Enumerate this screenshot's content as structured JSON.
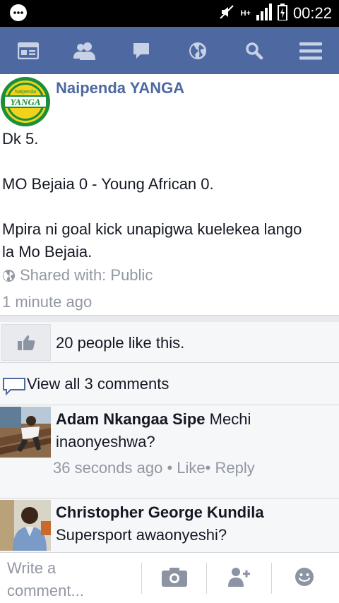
{
  "status_bar": {
    "time": "00:22",
    "network": "H+"
  },
  "nav": {
    "items": [
      "news-feed",
      "friend-requests",
      "messages",
      "notifications",
      "search",
      "more-menu"
    ]
  },
  "post": {
    "page_name": "Naipenda YANGA",
    "avatar_text_top": "Naipenda",
    "avatar_text_main": "YANGA",
    "lines": [
      "Dk 5.",
      "",
      "MO Bejaia 0 - Young African 0.",
      "",
      "Mpira ni goal kick unapigwa kuelekea lango",
      "la Mo Bejaia."
    ],
    "shared_with": "Shared with: Public",
    "timestamp": "1 minute ago"
  },
  "likes": {
    "text": "20 people like this."
  },
  "comments": {
    "view_all": "View all 3 comments",
    "items": [
      {
        "author": "Adam Nkangaa Sipe",
        "text_first": "Mechi",
        "text_second": "inaonyeshwa?",
        "time": "36 seconds ago",
        "sep1": " • ",
        "like": "Like",
        "sep2": "• ",
        "reply": "Reply"
      },
      {
        "author": "Christopher George Kundila",
        "text": "Supersport awaonyeshi?"
      }
    ]
  },
  "composer": {
    "placeholder_line1": "Write a",
    "placeholder_line2": "comment..."
  }
}
